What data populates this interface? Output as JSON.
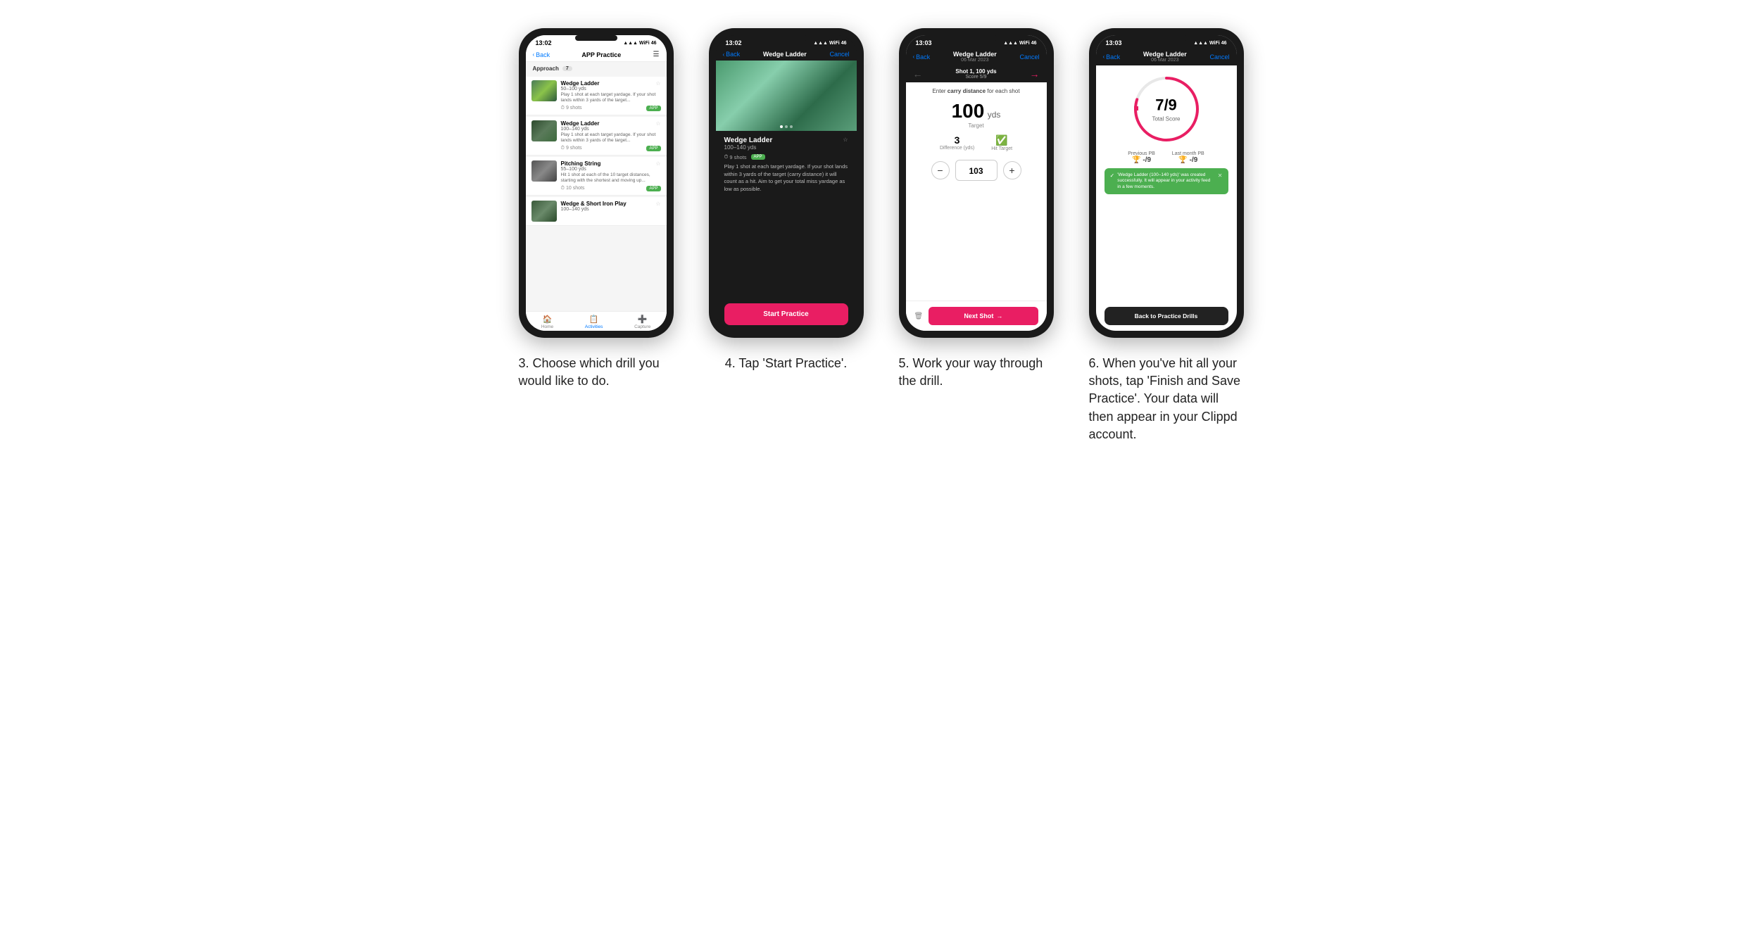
{
  "phones": [
    {
      "id": "phone1",
      "status_bar": {
        "time": "13:02",
        "signal": "▲▲▲",
        "wifi": "WiFi",
        "battery": "46"
      },
      "nav": {
        "back": "Back",
        "title": "APP Practice",
        "action": "☰"
      },
      "section": {
        "label": "Approach",
        "count": "7"
      },
      "drills": [
        {
          "name": "Wedge Ladder",
          "range": "50–100 yds",
          "desc": "Play 1 shot at each target yardage. If your shot lands within 3 yards of the target...",
          "shots": "9 shots",
          "badge": "APP"
        },
        {
          "name": "Wedge Ladder",
          "range": "100–140 yds",
          "desc": "Play 1 shot at each target yardage. If your shot lands within 3 yards of the target...",
          "shots": "9 shots",
          "badge": "APP"
        },
        {
          "name": "Pitching String",
          "range": "55–100 yds",
          "desc": "Hit 1 shot at each of the 10 target distances, starting with the shortest and moving up...",
          "shots": "10 shots",
          "badge": "APP"
        },
        {
          "name": "Wedge & Short Iron Play",
          "range": "100–140 yds",
          "desc": "",
          "shots": "",
          "badge": ""
        }
      ],
      "tab_bar": [
        {
          "icon": "🏠",
          "label": "Home",
          "active": false
        },
        {
          "icon": "📋",
          "label": "Activities",
          "active": true
        },
        {
          "icon": "➕",
          "label": "Capture",
          "active": false
        }
      ],
      "caption": "3. Choose which drill you would like to do."
    },
    {
      "id": "phone2",
      "status_bar": {
        "time": "13:02",
        "signal": "▲▲▲",
        "wifi": "WiFi",
        "battery": "46"
      },
      "nav": {
        "back": "Back",
        "title": "Wedge Ladder",
        "action": "Cancel"
      },
      "drill": {
        "name": "Wedge Ladder",
        "range": "100–140 yds",
        "shots": "9 shots",
        "badge": "APP",
        "desc": "Play 1 shot at each target yardage. If your shot lands within 3 yards of the target (carry distance) it will count as a hit. Aim to get your total miss yardage as low as possible."
      },
      "start_btn": "Start Practice",
      "caption": "4. Tap 'Start Practice'."
    },
    {
      "id": "phone3",
      "status_bar": {
        "time": "13:03",
        "signal": "▲▲▲",
        "wifi": "WiFi",
        "battery": "46"
      },
      "nav": {
        "back": "Back",
        "title": "Wedge Ladder",
        "subtitle": "06 Mar 2023",
        "action": "Cancel",
        "shot_label": "Shot 1, 100 yds",
        "score_label": "Score 5/9"
      },
      "carry_label": "Enter carry distance for each shot",
      "carry_bold": "carry distance",
      "target_yds": "100",
      "target_unit": "yds",
      "target_label": "Target",
      "difference": "3",
      "difference_label": "Difference (yds)",
      "hit_target_label": "Hit Target",
      "input_value": "103",
      "next_shot_label": "Next Shot",
      "caption": "5. Work your way through the drill."
    },
    {
      "id": "phone4",
      "status_bar": {
        "time": "13:03",
        "signal": "▲▲▲",
        "wifi": "WiFi",
        "battery": "46"
      },
      "nav": {
        "back": "Back",
        "title": "Wedge Ladder",
        "subtitle": "06 Mar 2023",
        "action": "Cancel"
      },
      "score": "7/9",
      "score_label": "Total Score",
      "prev_pb_label": "Previous PB",
      "prev_pb_val": "-/9",
      "last_month_label": "Last month PB",
      "last_month_val": "-/9",
      "toast": "'Wedge Ladder (100–140 yds)' was created successfully. It will appear in your activity feed in a few moments.",
      "back_btn": "Back to Practice Drills",
      "caption": "6. When you've hit all your shots, tap 'Finish and Save Practice'. Your data will then appear in your Clippd account."
    }
  ]
}
